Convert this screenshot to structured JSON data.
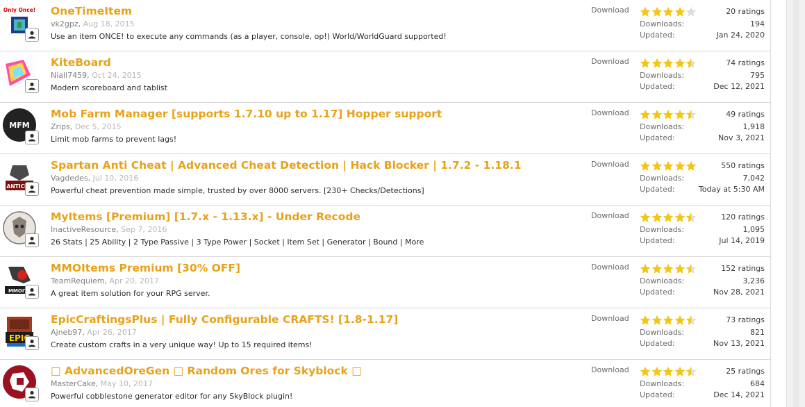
{
  "download_label": "Download",
  "downloads_label": "Downloads:",
  "updated_label": "Updated:",
  "star_color": "#f3c515",
  "star_empty_color": "#dddddd",
  "resources": [
    {
      "title": "OneTimeItem",
      "author": "vk2gpz",
      "date": "Aug 18, 2015",
      "tagline": "Use an item ONCE! to execute any commands (as a player, console, op!) World/WorldGuard supported!",
      "icon": "onetimeitem-icon",
      "icon_text": "Only Once!",
      "stars": 4.0,
      "ratings": "20 ratings",
      "downloads": "194",
      "updated": "Jan 24, 2020"
    },
    {
      "title": "KiteBoard",
      "author": "Niall7459",
      "date": "Oct 24, 2015",
      "tagline": "Modern scoreboard and tablist",
      "icon": "kiteboard-icon",
      "icon_text": "",
      "stars": 4.5,
      "ratings": "74 ratings",
      "downloads": "795",
      "updated": "Dec 12, 2021"
    },
    {
      "title": "Mob Farm Manager [supports 1.7.10 up to 1.17] Hopper support",
      "author": "Zrips",
      "date": "Dec 5, 2015",
      "tagline": "Limit mob farms to prevent lags!",
      "icon": "mfm-icon",
      "icon_text": "MFM",
      "stars": 4.5,
      "ratings": "49 ratings",
      "downloads": "1,918",
      "updated": "Nov 3, 2021"
    },
    {
      "title": "Spartan Anti Cheat | Advanced Cheat Detection | Hack Blocker | 1.7.2 - 1.18.1",
      "author": "Vagdedes",
      "date": "Jul 10, 2016",
      "tagline": "Powerful cheat prevention made simple, trusted by over 8000 servers. [230+ Checks/Detections]",
      "icon": "spartan-icon",
      "icon_text": "ANTICHE",
      "stars": 5.0,
      "ratings": "550 ratings",
      "downloads": "7,042",
      "updated": "Today at 5:30 AM"
    },
    {
      "title": "MyItems [Premium] [1.7.x - 1.13.x] - Under Recode",
      "author": "InactiveResource",
      "date": "Sep 7, 2016",
      "tagline": "26 Stats | 25 Ability | 2 Type Passive | 3 Type Power | Socket | Item Set | Generator | Bound | More",
      "icon": "myitems-icon",
      "icon_text": "",
      "stars": 4.5,
      "ratings": "120 ratings",
      "downloads": "1,095",
      "updated": "Jul 14, 2019"
    },
    {
      "title": "MMOItems Premium [30% OFF]",
      "author": "TeamRequiem",
      "date": "Apr 20, 2017",
      "tagline": "A great item solution for your RPG server.",
      "icon": "mmoitems-icon",
      "icon_text": "MMOITE",
      "stars": 4.5,
      "ratings": "152 ratings",
      "downloads": "3,236",
      "updated": "Nov 28, 2021"
    },
    {
      "title": "EpicCraftingsPlus | Fully Configurable CRAFTS! [1.8-1.17]",
      "author": "Ajneb97",
      "date": "Apr 26, 2017",
      "tagline": "Create custom crafts in a very unique way! Up to 15 required items!",
      "icon": "epiccraftings-icon",
      "icon_text": "EPIC",
      "stars": 4.5,
      "ratings": "73 ratings",
      "downloads": "821",
      "updated": "Nov 13, 2021"
    },
    {
      "title": "□ AdvancedOreGen □ Random Ores for Skyblock □",
      "author": "MasterCake",
      "date": "May 10, 2017",
      "tagline": "Powerful cobblestone generator editor for any SkyBlock plugin!",
      "icon": "advancedoregen-icon",
      "icon_text": "",
      "stars": 4.5,
      "ratings": "25 ratings",
      "downloads": "684",
      "updated": "Dec 14, 2021"
    }
  ]
}
